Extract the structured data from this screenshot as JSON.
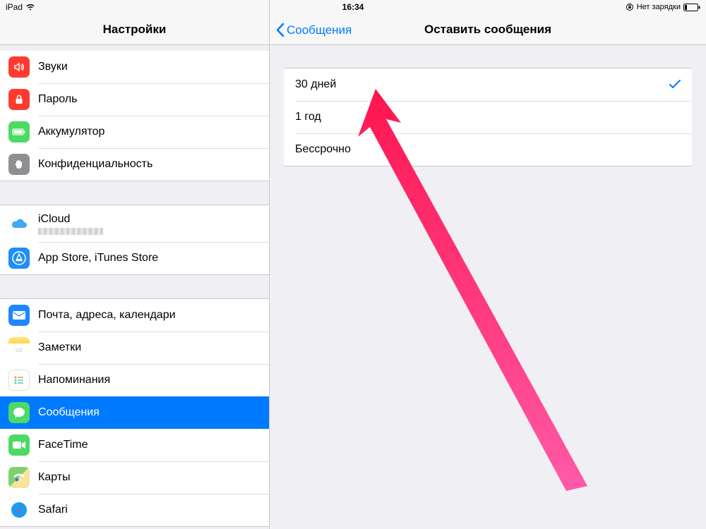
{
  "statusbar": {
    "device": "iPad",
    "time": "16:34",
    "charging_text": "Нет зарядки"
  },
  "sidebar": {
    "title": "Настройки",
    "group1": [
      {
        "id": "sounds",
        "label": "Звуки",
        "color": "#ff3b30"
      },
      {
        "id": "passcode",
        "label": "Пароль",
        "color": "#ff3b30"
      },
      {
        "id": "battery",
        "label": "Аккумулятор",
        "color": "#4cd964"
      },
      {
        "id": "privacy",
        "label": "Конфиденциальность",
        "color": "#8e8e93"
      }
    ],
    "group2": [
      {
        "id": "icloud",
        "label": "iCloud"
      },
      {
        "id": "appstore",
        "label": "App Store, iTunes Store"
      }
    ],
    "group3": [
      {
        "id": "mail",
        "label": "Почта, адреса, календари",
        "color": "#007aff"
      },
      {
        "id": "notes",
        "label": "Заметки",
        "color": "#ffcc00"
      },
      {
        "id": "reminders",
        "label": "Напоминания",
        "color": "#ffffff"
      },
      {
        "id": "messages",
        "label": "Сообщения",
        "color": "#4cd964",
        "selected": true
      },
      {
        "id": "facetime",
        "label": "FaceTime",
        "color": "#4cd964"
      },
      {
        "id": "maps",
        "label": "Карты",
        "color": "#71c66a"
      },
      {
        "id": "safari",
        "label": "Safari",
        "color": "#ffffff"
      }
    ]
  },
  "detail": {
    "back_label": "Сообщения",
    "title": "Оставить сообщения",
    "options": [
      {
        "id": "30d",
        "label": "30 дней",
        "checked": true
      },
      {
        "id": "1y",
        "label": "1 год",
        "checked": false
      },
      {
        "id": "forever",
        "label": "Бессрочно",
        "checked": false
      }
    ]
  }
}
